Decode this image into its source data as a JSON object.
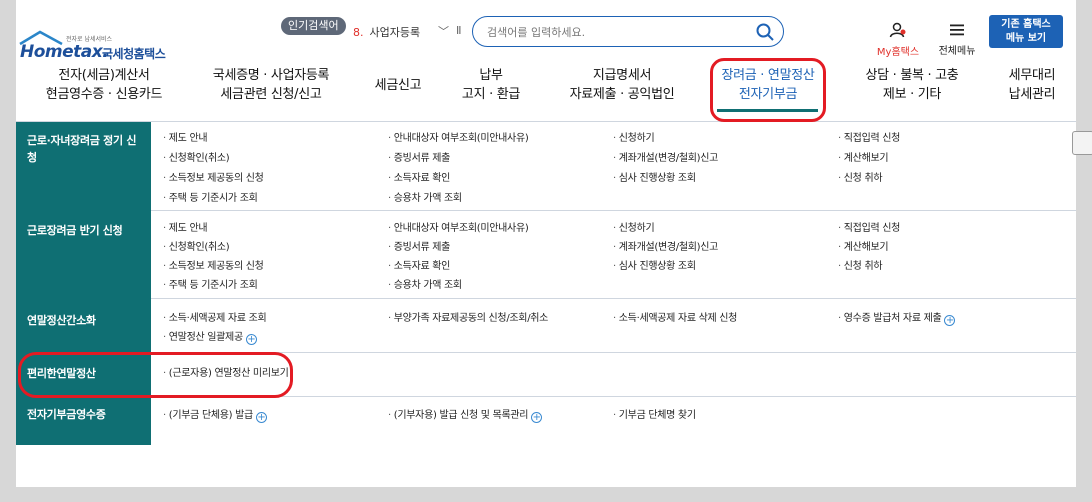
{
  "header": {
    "logo_sub": "전자로 납세서비스",
    "logo_main": "Hometax.",
    "logo_kr": "국세청홈택스",
    "popular_badge": "인기검색어",
    "popular_num": "8.",
    "popular_term": "사업자등록",
    "pause": "II",
    "search_placeholder": "검색어를 입력하세요.",
    "myhome_label": "My홈택스",
    "allmenu_label": "전체메뉴",
    "classic_line1": "기존 홈택스",
    "classic_line2": "메뉴 보기"
  },
  "nav": [
    {
      "line1": "전자(세금)계산서",
      "line2": "현금영수증 · 신용카드"
    },
    {
      "line1": "국세증명 · 사업자등록",
      "line2": "세금관련 신청/신고"
    },
    {
      "line1": "세금신고",
      "line2": ""
    },
    {
      "line1": "납부",
      "line2": "고지 · 환급"
    },
    {
      "line1": "지급명세서",
      "line2": "자료제출 · 공익법인"
    },
    {
      "line1": "장려금 · 연말정산",
      "line2": "전자기부금"
    },
    {
      "line1": "상담 · 불복 · 고충",
      "line2": "제보 · 기타"
    },
    {
      "line1": "세무대리",
      "line2": "납세관리"
    }
  ],
  "rows": [
    {
      "title": "근로·자녀장려금 정기 신청",
      "links": [
        "제도 안내",
        "안내대상자 여부조회(미안내사유)",
        "신청하기",
        "직접입력 신청",
        "신청확인(취소)",
        "증빙서류 제출",
        "계좌개설(변경/철회)신고",
        "계산해보기",
        "소득정보 제공동의 신청",
        "소득자료 확인",
        "심사 진행상황 조회",
        "신청 취하",
        "주택 등 기준시가 조회",
        "승용차 가액 조회"
      ]
    },
    {
      "title": "근로장려금 반기 신청",
      "links": [
        "제도 안내",
        "안내대상자 여부조회(미안내사유)",
        "신청하기",
        "직접입력 신청",
        "신청확인(취소)",
        "증빙서류 제출",
        "계좌개설(변경/철회)신고",
        "계산해보기",
        "소득정보 제공동의 신청",
        "소득자료 확인",
        "심사 진행상황 조회",
        "신청 취하",
        "주택 등 기준시가 조회",
        "승용차 가액 조회"
      ]
    },
    {
      "title": "연말정산간소화",
      "links": [
        "소득·세액공제 자료 조회",
        "부양가족 자료제공동의 신청/조회/취소",
        "소득·세액공제 자료 삭제 신청",
        "영수증 발급처 자료 제출",
        "연말정산 일괄제공"
      ]
    },
    {
      "title": "편리한연말정산",
      "links": [
        "(근로자용) 연말정산 미리보기"
      ]
    },
    {
      "title": "전자기부금영수증",
      "links": [
        "(기부금 단체용) 발급",
        "(기부자용) 발급 신청 및 목록관리",
        "기부금 단체명 찾기"
      ]
    }
  ],
  "colors": {
    "accent": "#1d62b5",
    "row_header": "#0f6f73",
    "highlight": "#e31b23"
  }
}
